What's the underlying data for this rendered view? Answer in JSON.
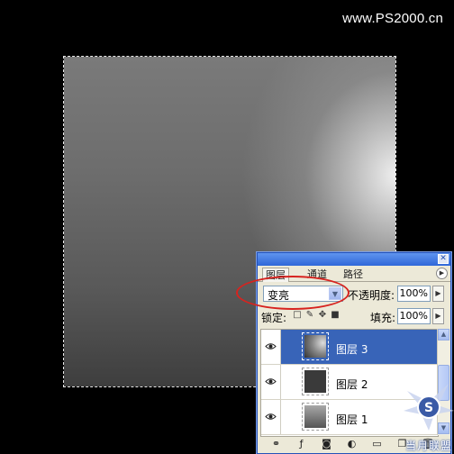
{
  "watermark": "www.PS2000.cn",
  "panel": {
    "tabs": [
      {
        "label": "图层",
        "active": true
      },
      {
        "label": "通道",
        "active": false
      },
      {
        "label": "路径",
        "active": false
      }
    ],
    "blend_mode": "变亮",
    "opacity_label": "不透明度:",
    "opacity_value": "100%",
    "lock_label": "锁定:",
    "fill_label": "填充:",
    "fill_value": "100%",
    "layers": [
      {
        "name": "图层 3",
        "selected": true,
        "visible": true,
        "thumbnail": "radial-gradient"
      },
      {
        "name": "图层 2",
        "selected": false,
        "visible": true,
        "thumbnail": "dark-gray"
      },
      {
        "name": "图层 1",
        "selected": false,
        "visible": true,
        "thumbnail": "linear-gradient"
      }
    ],
    "bottom_icons": [
      "link-icon",
      "add-style-icon",
      "add-mask-icon",
      "adjustment-layer-icon",
      "new-group-icon",
      "new-layer-icon",
      "delete-layer-icon"
    ]
  },
  "annotation": {
    "color": "#d7231f",
    "target": "blend-mode-select"
  },
  "logo": {
    "text": "当月联盟",
    "glyph": "S"
  },
  "colors": {
    "background": "#000000",
    "title_bar": "#2f67d9",
    "selection": "#3864b8"
  }
}
